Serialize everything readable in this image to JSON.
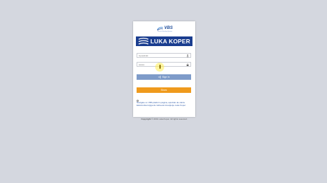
{
  "logos": {
    "vbs_text": "VBS",
    "vbs_subtitle": "Vehicle Booking System",
    "luka_text": "LUKA KOPER"
  },
  "form": {
    "username_placeholder": "Uporabnik",
    "password_value": "••••••••",
    "signin_label": "Sign in",
    "show_label": "Show"
  },
  "notice": {
    "line1": "Navigate on VBS platform página, aprobán de oferta",
    "line2": "Elektronika knjiga dé zahtevek dovoljenje Luka Koper"
  },
  "footer": {
    "copyright_label": "Copyright",
    "copyright_text": "© 2019 Luka Koper. All rights reserved."
  },
  "colors": {
    "background": "#d4d7df",
    "brand_blue": "#1a3d8f",
    "signin_button": "#7e9bc9",
    "show_button": "#ef9a1c"
  },
  "icons": {
    "username_field": "user-icon",
    "password_field": "lock-icon",
    "signin_button": "sign-in-icon"
  }
}
